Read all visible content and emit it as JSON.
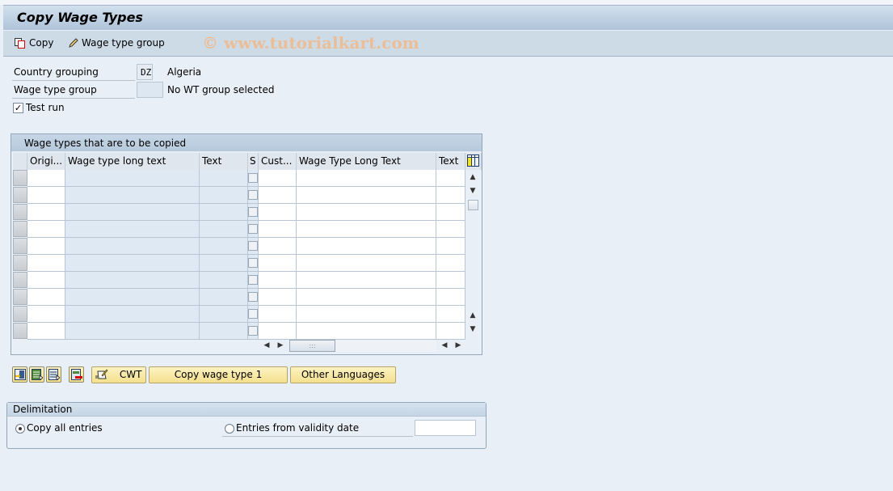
{
  "window": {
    "title": "Copy Wage Types"
  },
  "toolbar": {
    "copy_label": "Copy",
    "wage_type_group_label": "Wage type group",
    "watermark": "© www.tutorialkart.com"
  },
  "selection": {
    "country_grouping": {
      "label": "Country grouping",
      "value": "DZ",
      "description": "Algeria"
    },
    "wage_type_group": {
      "label": "Wage type group",
      "value": "",
      "description": "No WT group selected"
    },
    "test_run": {
      "label": "Test run",
      "checked": true
    }
  },
  "table": {
    "title": "Wage types that are to be copied",
    "columns": [
      "Origi...",
      "Wage type long text",
      "Text",
      "S",
      "Cust...",
      "Wage Type Long Text",
      "Text"
    ],
    "row_count": 10,
    "rows": []
  },
  "actions": {
    "cwt_label": "CWT",
    "copy_wage_type_label": "Copy wage type 1",
    "other_languages_label": "Other Languages"
  },
  "delimitation": {
    "title": "Delimitation",
    "options": [
      {
        "label": "Copy all entries",
        "selected": true
      },
      {
        "label": "Entries from validity date",
        "selected": false
      }
    ],
    "validity_date": ""
  }
}
